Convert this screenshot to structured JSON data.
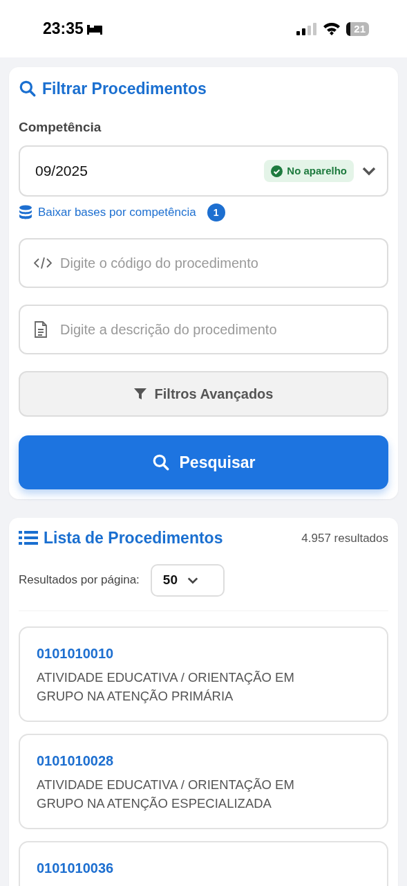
{
  "status_bar": {
    "time": "23:35",
    "battery": "21"
  },
  "filter": {
    "title": "Filtrar Procedimentos",
    "competence_label": "Competência",
    "competence_value": "09/2025",
    "device_badge": "No aparelho",
    "download_link": "Baixar bases por competência",
    "download_count": "1",
    "code_field": {
      "placeholder": "Digite o código do procedimento"
    },
    "description_field": {
      "placeholder": "Digite a descrição do procedimento"
    },
    "advanced_button": "Filtros Avançados",
    "search_button": "Pesquisar"
  },
  "list": {
    "title": "Lista de Procedimentos",
    "result_count": "4.957 resultados",
    "per_page_label": "Resultados por página:",
    "per_page_value": "50",
    "items": [
      {
        "code": "0101010010",
        "description": "ATIVIDADE EDUCATIVA / ORIENTAÇÃO EM GRUPO NA ATENÇÃO PRIMÁRIA"
      },
      {
        "code": "0101010028",
        "description": "ATIVIDADE EDUCATIVA / ORIENTAÇÃO EM GRUPO NA ATENÇÃO ESPECIALIZADA"
      },
      {
        "code": "0101010036"
      }
    ]
  }
}
